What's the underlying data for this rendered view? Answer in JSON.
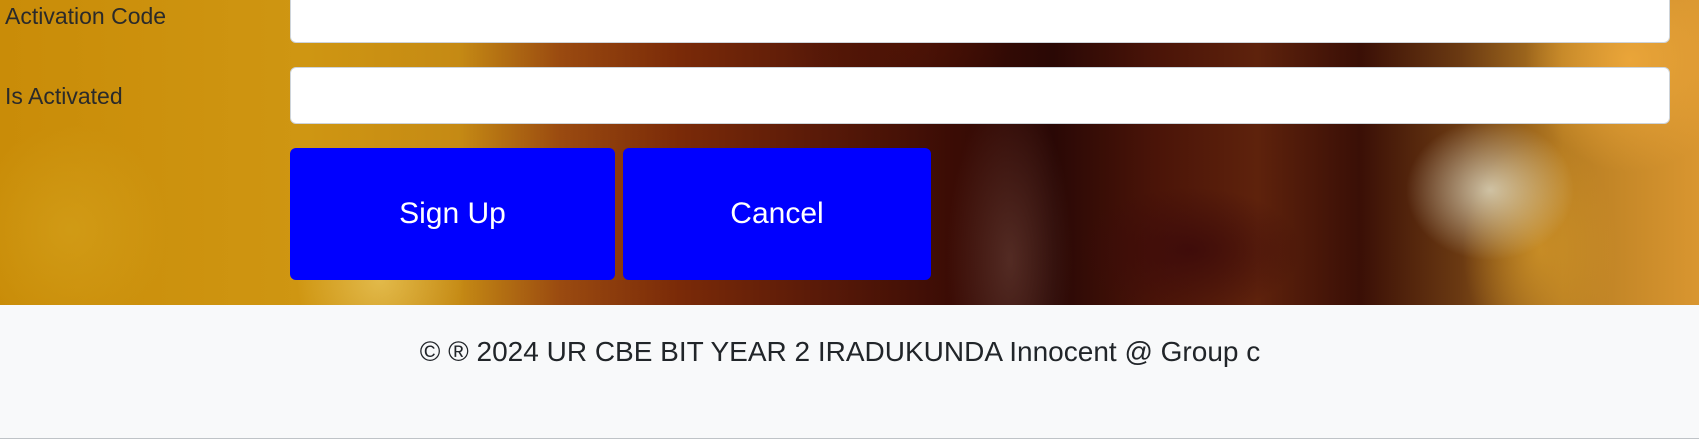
{
  "form": {
    "activation_code": {
      "label": "Activation Code",
      "value": "",
      "placeholder": ""
    },
    "is_activated": {
      "label": "Is Activated",
      "value": "",
      "placeholder": ""
    },
    "buttons": {
      "sign_up": "Sign Up",
      "cancel": "Cancel"
    }
  },
  "colors": {
    "button_background": "#0000ff",
    "button_text": "#ffffff",
    "footer_background": "#f8f9fa"
  },
  "footer": {
    "text": "© ® 2024 UR CBE BIT YEAR 2 IRADUKUNDA Innocent @ Group c"
  }
}
